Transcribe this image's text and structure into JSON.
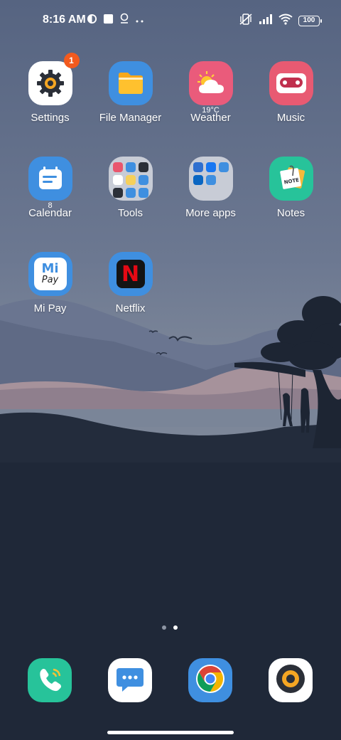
{
  "status_bar": {
    "time": "8:16 AM",
    "battery": "100",
    "left_icons": [
      "sync-icon",
      "square-notification-icon",
      "location-icon",
      "more-dots-icon"
    ],
    "right_icons": [
      "vibrate-off-icon",
      "signal-icon",
      "wifi-icon",
      "battery-icon"
    ]
  },
  "apps": [
    {
      "name": "settings",
      "label": "Settings",
      "badge": "1",
      "icon": "gear-icon"
    },
    {
      "name": "file-manager",
      "label": "File Manager",
      "icon": "folder-icon"
    },
    {
      "name": "weather",
      "label": "Weather",
      "sub": "19°C",
      "icon": "weather-sun-cloud-icon"
    },
    {
      "name": "music",
      "label": "Music",
      "icon": "cassette-icon"
    },
    {
      "name": "calendar",
      "label": "Calendar",
      "sub": "8",
      "icon": "calendar-icon"
    },
    {
      "name": "tools",
      "label": "Tools",
      "icon": "tools-folder-icon"
    },
    {
      "name": "more-apps",
      "label": "More apps",
      "icon": "more-apps-folder-icon"
    },
    {
      "name": "notes",
      "label": "Notes",
      "note_text": "NOTE",
      "icon": "note-icon"
    },
    {
      "name": "mi-pay",
      "label": "Mi Pay",
      "logo_top": "Mi",
      "logo_bottom": "Pay",
      "icon": "mi-pay-icon"
    },
    {
      "name": "netflix",
      "label": "Netflix",
      "logo": "N",
      "icon": "netflix-icon"
    }
  ],
  "dock": [
    {
      "name": "phone",
      "icon": "phone-icon"
    },
    {
      "name": "messages",
      "icon": "messages-icon"
    },
    {
      "name": "chrome",
      "icon": "chrome-icon"
    },
    {
      "name": "camera",
      "icon": "camera-icon"
    }
  ],
  "pager": {
    "pages": 2,
    "current": 2
  },
  "colors": {
    "sky_top": "#5d6b86",
    "sky_bottom": "#8a95a6",
    "ground": "#1f2838",
    "badge": "#f25a1e",
    "settings_icon_bg": "#ffffff",
    "file_manager_bg": "#3f8fe0",
    "weather_bg": "#ea5b7b",
    "music_bg": "#e85a72",
    "calendar_bg": "#3f8fe0",
    "notes_bg": "#27c39a",
    "mipay_bg": "#3f8fe0",
    "netflix_bg": "#3f8fe0",
    "phone_bg": "#27c39a",
    "messages_bg": "#3f8fe0",
    "chrome_bg": "#3f8fe0",
    "camera_bg": "#ffffff"
  }
}
